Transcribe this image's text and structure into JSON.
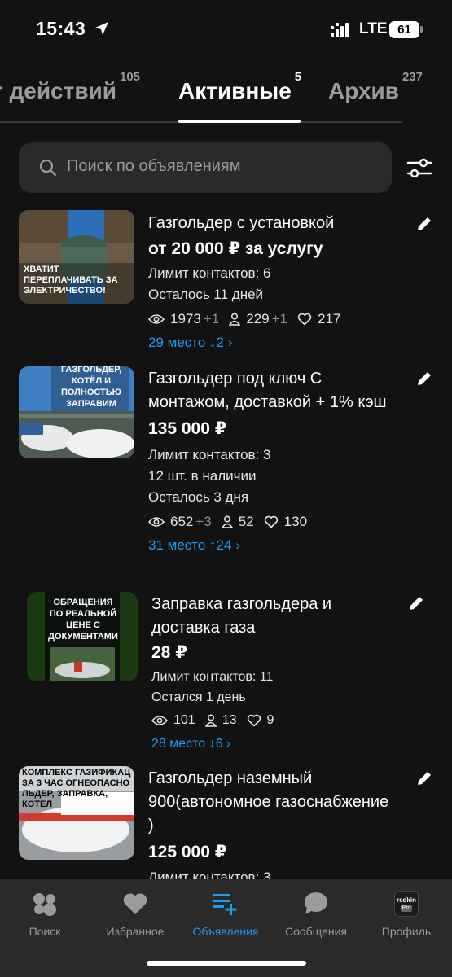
{
  "status": {
    "time": "15:43",
    "network": "LTE",
    "battery": "61"
  },
  "tabs": [
    {
      "label": "т действий",
      "count": "105"
    },
    {
      "label": "Активные",
      "count": "5"
    },
    {
      "label": "Архив",
      "count": "237"
    }
  ],
  "search": {
    "placeholder": "Поиск по объявлениям"
  },
  "listings": [
    {
      "thumb_text": "ХВАТИТ ПЕРЕПЛАЧИВАТЬ ЗА ЭЛЕКТРИЧЕСТВО!",
      "title": "Газгольдер с установкой",
      "price": "от 20 000 ₽ за услугу",
      "meta": [
        "Лимит контактов: 6",
        "Осталось 11 дней"
      ],
      "views": "1973",
      "views_delta": "+1",
      "contacts": "229",
      "contacts_delta": "+1",
      "favorites": "217",
      "rank": "29 место ↓2"
    },
    {
      "thumb_text": "ГАЗГОЛЬДЕР, КОТЁЛ И ПОЛНОСТЬЮ ЗАПРАВИМ",
      "title": "Газгольдер под ключ С монтажом, доставкой + 1% кэш",
      "price": "135 000 ₽",
      "meta": [
        "Лимит контактов: 3",
        "12 шт. в наличии",
        "Осталось 3 дня"
      ],
      "views": "652",
      "views_delta": "+3",
      "contacts": "52",
      "contacts_delta": "",
      "favorites": "130",
      "rank": "31 место ↑24"
    },
    {
      "thumb_text": "ОБРАЩЕНИЯ ПО РЕАЛЬНОЙ ЦЕНЕ С ДОКУМЕНТАМИ",
      "title": "Заправка газгольдера и доставка газа",
      "price": "28 ₽",
      "meta": [
        "Лимит контактов: 11",
        "Остался 1 день"
      ],
      "views": "101",
      "views_delta": "",
      "contacts": "13",
      "contacts_delta": "",
      "favorites": "9",
      "rank": "28 место ↓6"
    },
    {
      "thumb_text": "КОМПЛЕКС ГАЗИФИКАЦ ЗА 3 ЧАС ОГНЕОПАСНО ЛЬДЕР, ЗАПРАВКА, КОТЕЛ",
      "title": "Газгольдер наземный 900(автономное газоснабжение )",
      "price": "125 000 ₽",
      "meta": [
        "Лимит контактов: 3"
      ],
      "views": "",
      "views_delta": "",
      "contacts": "",
      "contacts_delta": "",
      "favorites": "",
      "rank": ""
    }
  ],
  "nav": [
    {
      "label": "Поиск",
      "icon": "search-bubbles-icon"
    },
    {
      "label": "Избранное",
      "icon": "heart-icon"
    },
    {
      "label": "Объявления",
      "icon": "listings-add-icon",
      "active": true
    },
    {
      "label": "Сообщения",
      "icon": "chat-icon"
    },
    {
      "label": "Профиль",
      "icon": "avatar-icon",
      "avatar_text": "redkin",
      "avatar_badge": "Pro"
    }
  ],
  "colors": {
    "accent": "#1e9bf0",
    "background": "#121212",
    "surface": "#2a2a2a"
  }
}
